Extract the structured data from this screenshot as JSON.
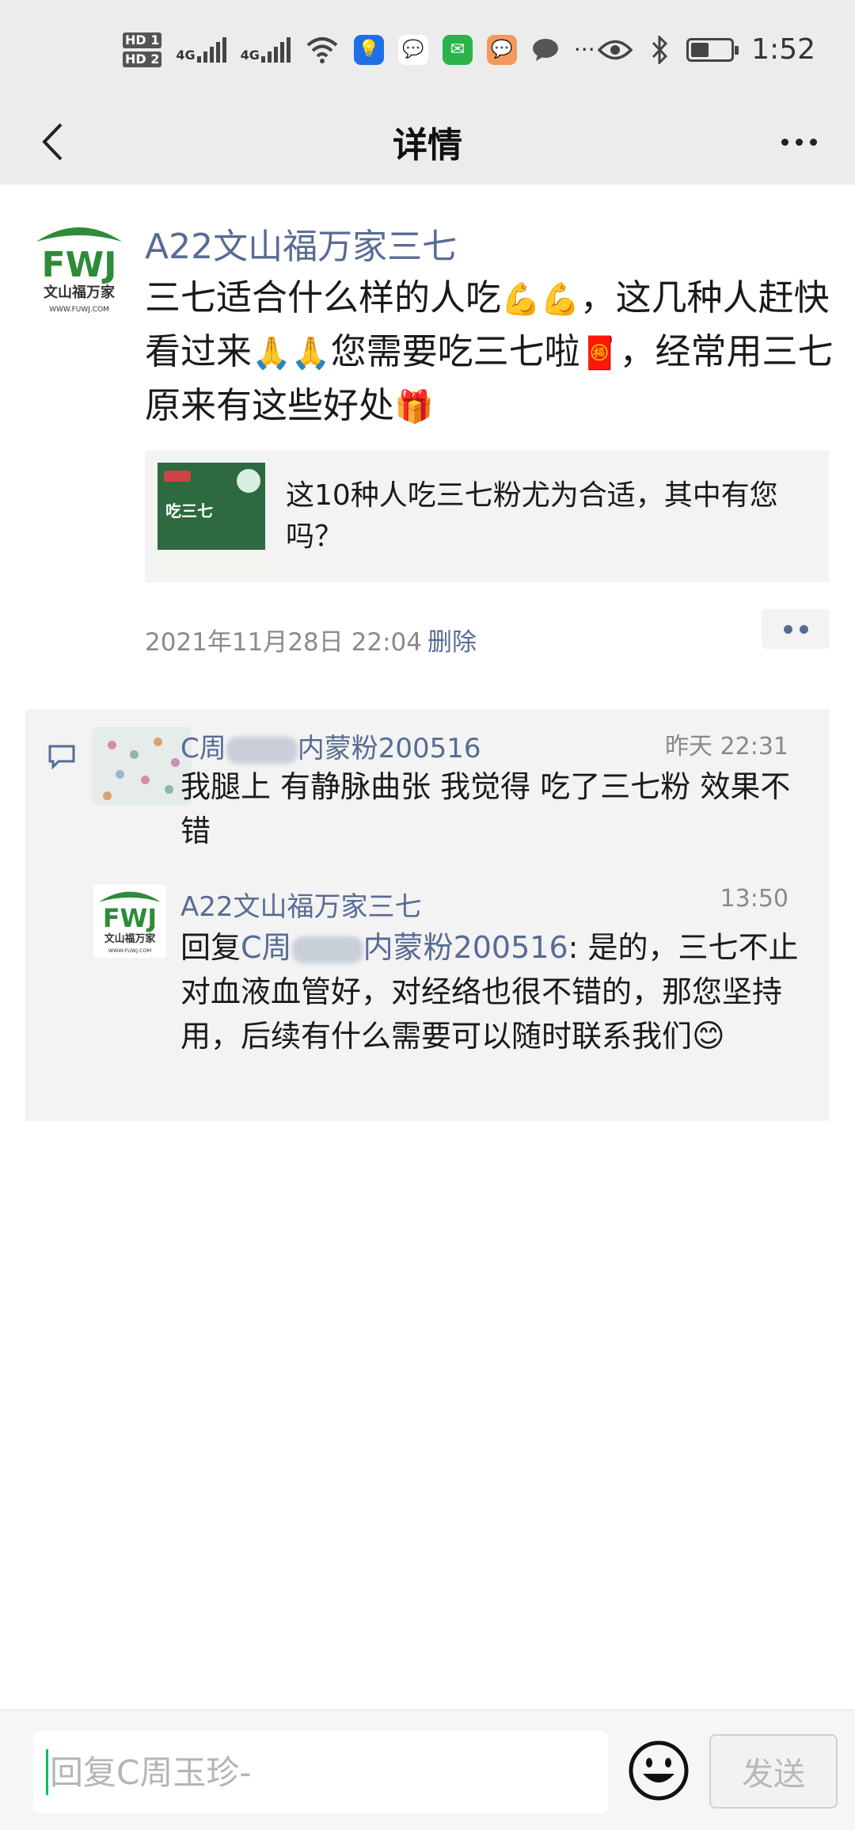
{
  "status_bar": {
    "hd1": "HD 1",
    "hd2": "HD 2",
    "net1": "4G",
    "net2": "4G",
    "time": "1:52"
  },
  "nav": {
    "title": "详情"
  },
  "post": {
    "author": "A22文山福万家三七",
    "avatar_logo_text": "FWJ",
    "avatar_logo_sub": "文山福万家",
    "avatar_logo_url": "WWW.FUWJ.COM",
    "text_1": "三七适合什么样的人吃",
    "emoji_1": "💪💪",
    "text_2": "，这几种人赶快看过来",
    "emoji_2": "🙏🙏",
    "text_3": "您需要吃三七啦",
    "emoji_3": "🧧",
    "text_4": "，经常用三七原来有这些好处",
    "emoji_4": "🎁",
    "link_title": "这10种人吃三七粉尤为合适，其中有您吗？",
    "link_thumb_text": "吃三七",
    "timestamp": "2021年11月28日 22:04",
    "delete_label": "删除"
  },
  "comment": {
    "name_prefix": "C周",
    "name_suffix": "内蒙粉200516",
    "time": "昨天 22:31",
    "text": "我腿上 有静脉曲张 我觉得 吃了三七粉 效果不错"
  },
  "reply": {
    "name": "A22文山福万家三七",
    "time": "13:50",
    "prefix": "回复",
    "target_prefix": "C周",
    "target_suffix": "内蒙粉200516",
    "text": ": 是的，三七不止对血液血管好，对经络也很不错的，那您坚持用，后续有什么需要可以随时联系我们",
    "emoji": "😊"
  },
  "input_bar": {
    "placeholder": "回复C周玉珍-",
    "send_label": "发送"
  },
  "colors": {
    "link_blue": "#576b95",
    "accent_green": "#07c160",
    "header_bg": "#ececec"
  }
}
